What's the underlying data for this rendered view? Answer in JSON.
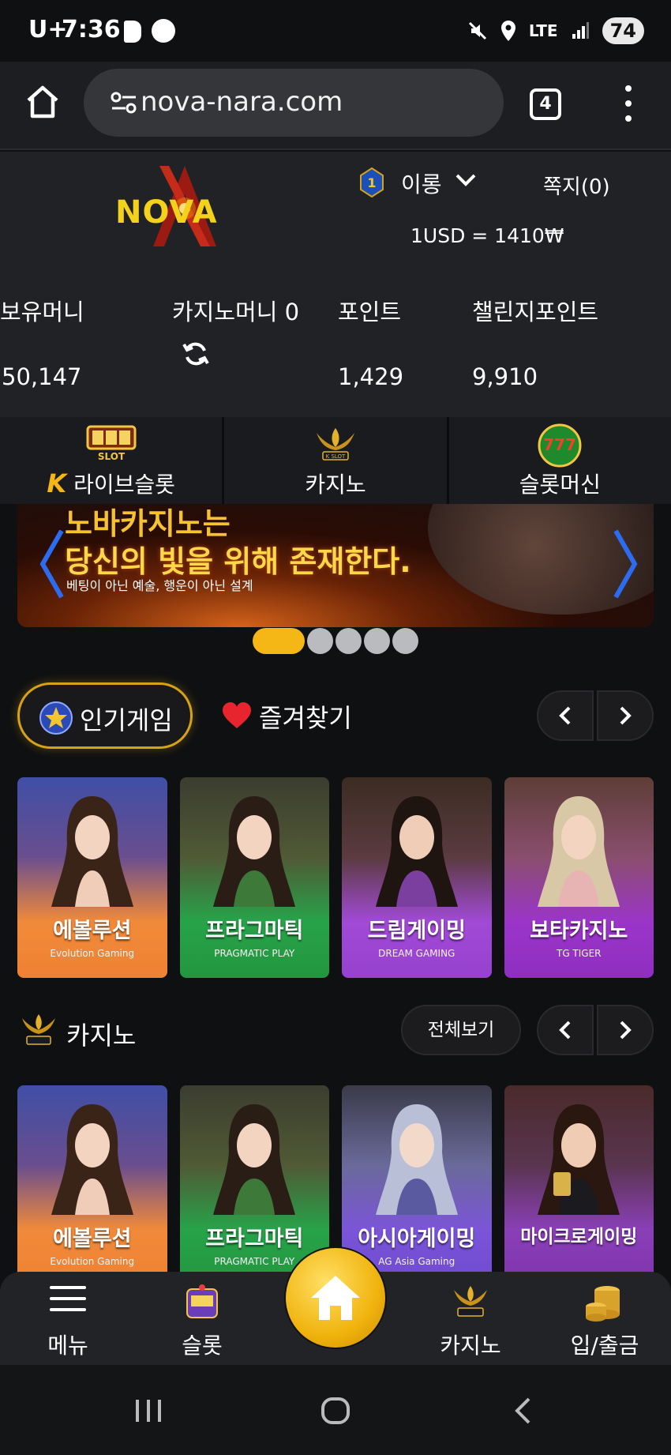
{
  "status_bar": {
    "carrier": "U+",
    "time": "7:36",
    "network": "LTE",
    "battery": "74"
  },
  "browser": {
    "url": "nova-nara.com",
    "tab_count": "4"
  },
  "header": {
    "logo": "NOVA",
    "username": "이롱",
    "level": "1",
    "messages": "쪽지(0)",
    "exchange_rate": "1USD = 1410₩"
  },
  "wallet": {
    "holding_label": "보유머니",
    "holding_value": "50,147",
    "casino_label": "카지노머니 0",
    "points_label": "포인트",
    "points_value": "1,429",
    "challenge_label": "챌린지포인트",
    "challenge_value": "9,910"
  },
  "categories": [
    {
      "label": "라이브슬롯",
      "icon": "live-slot-icon"
    },
    {
      "label": "카지노",
      "icon": "casino-icon"
    },
    {
      "label": "슬롯머신",
      "icon": "slot-777-icon"
    }
  ],
  "banner": {
    "line1": "노바카지노는",
    "line2": "당신의 빛을 위해 존재한다.",
    "line3": "베팅이 아닌 예술, 행운이 아닌 설계"
  },
  "carousel": {
    "slides": 5,
    "active": 1
  },
  "popular": {
    "tab_active": "인기게임",
    "tab_fav": "즐겨찾기",
    "games": [
      {
        "name": "에볼루션",
        "provider": "Evolution Gaming",
        "theme": "orange"
      },
      {
        "name": "프라그마틱",
        "provider": "PRAGMATIC PLAY",
        "theme": "green"
      },
      {
        "name": "드림게이밍",
        "provider": "DREAM GAMING",
        "theme": "purple"
      },
      {
        "name": "보타카지노",
        "provider": "TG TIGER",
        "theme": "violet"
      }
    ]
  },
  "casino": {
    "title": "카지노",
    "view_all": "전체보기",
    "games": [
      {
        "name": "에볼루션",
        "provider": "Evolution Gaming",
        "theme": "orange"
      },
      {
        "name": "프라그마틱",
        "provider": "PRAGMATIC PLAY",
        "theme": "green"
      },
      {
        "name": "아시아게이밍",
        "provider": "AG Asia Gaming",
        "theme": "blue"
      },
      {
        "name": "마이크로게이밍",
        "provider": "",
        "theme": "dark"
      }
    ]
  },
  "bottom_nav": {
    "menu": "메뉴",
    "slot": "슬롯",
    "casino": "카지노",
    "bank": "입/출금"
  },
  "colors": {
    "accent": "#f5b715",
    "bg": "#0f1012",
    "panel": "#202226"
  }
}
